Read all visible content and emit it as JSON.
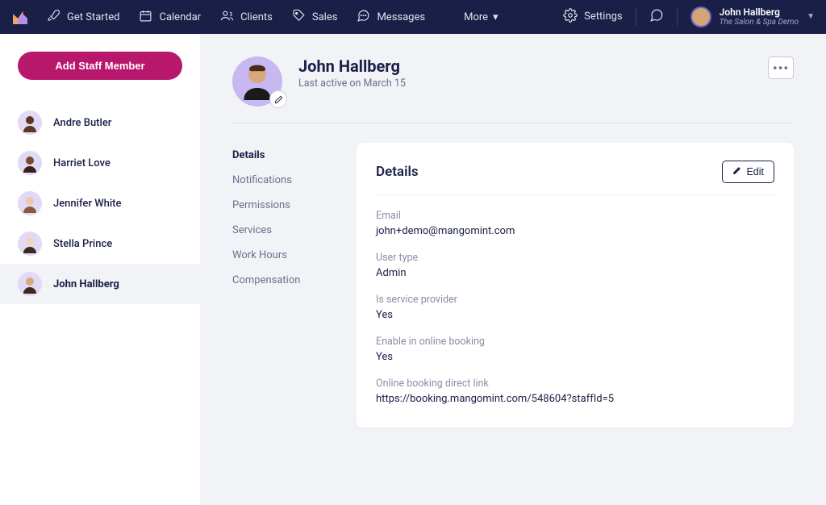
{
  "nav": {
    "items": [
      {
        "label": "Get Started"
      },
      {
        "label": "Calendar"
      },
      {
        "label": "Clients"
      },
      {
        "label": "Sales"
      },
      {
        "label": "Messages"
      }
    ],
    "more": "More",
    "settings": "Settings"
  },
  "user": {
    "name": "John Hallberg",
    "company": "The Salon & Spa Demo"
  },
  "sidebar": {
    "add_button": "Add Staff Member",
    "staff": [
      {
        "name": "Andre Butler"
      },
      {
        "name": "Harriet Love"
      },
      {
        "name": "Jennifer White"
      },
      {
        "name": "Stella Prince"
      },
      {
        "name": "John Hallberg"
      }
    ]
  },
  "profile": {
    "name": "John Hallberg",
    "last_active": "Last active on March 15"
  },
  "subnav": {
    "items": [
      {
        "label": "Details"
      },
      {
        "label": "Notifications"
      },
      {
        "label": "Permissions"
      },
      {
        "label": "Services"
      },
      {
        "label": "Work Hours"
      },
      {
        "label": "Compensation"
      }
    ]
  },
  "card": {
    "title": "Details",
    "edit": "Edit",
    "fields": [
      {
        "label": "Email",
        "value": "john+demo@mangomint.com"
      },
      {
        "label": "User type",
        "value": "Admin"
      },
      {
        "label": "Is service provider",
        "value": "Yes"
      },
      {
        "label": "Enable in online booking",
        "value": "Yes"
      },
      {
        "label": "Online booking direct link",
        "value": "https://booking.mangomint.com/548604?staffId=5"
      }
    ]
  }
}
